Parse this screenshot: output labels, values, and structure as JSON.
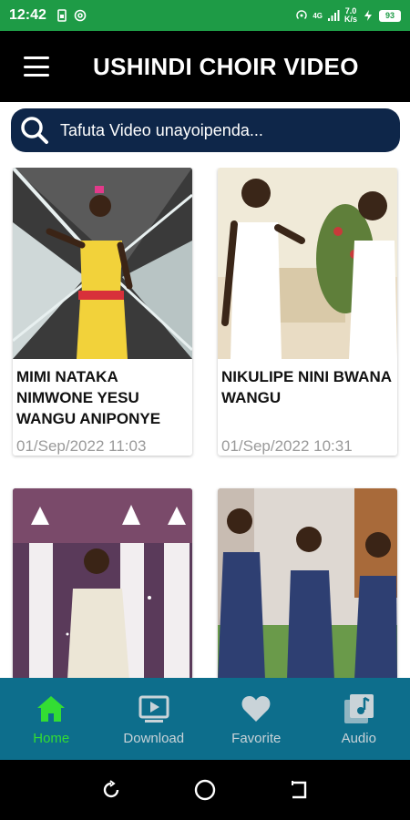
{
  "status_bar": {
    "time": "12:42",
    "net_speed_value": "7.0",
    "net_speed_unit": "K/s",
    "network_type": "4G",
    "battery": "93"
  },
  "app_bar": {
    "title": "USHINDI CHOIR VIDEO"
  },
  "search": {
    "placeholder": "Tafuta Video unayoipenda..."
  },
  "videos": [
    {
      "title": "MIMI NATAKA NIMWONE YESU WANGU ANIPONYE",
      "date": "01/Sep/2022 11:03"
    },
    {
      "title": "NIKULIPE NINI BWANA WANGU",
      "date": "01/Sep/2022 10:31"
    },
    {
      "title": "",
      "date": ""
    },
    {
      "title": "",
      "date": ""
    }
  ],
  "bottom_nav": [
    {
      "label": "Home",
      "icon": "home-icon",
      "active": true
    },
    {
      "label": "Download",
      "icon": "video-download-icon",
      "active": false
    },
    {
      "label": "Favorite",
      "icon": "heart-icon",
      "active": false
    },
    {
      "label": "Audio",
      "icon": "music-note-icon",
      "active": false
    }
  ],
  "colors": {
    "status_bar": "#1e9b46",
    "app_bar": "#000000",
    "search_bar": "#0e2649",
    "bottom_nav": "#0d6e8c",
    "active_nav": "#33dd33",
    "inactive_nav": "#c9d3d8"
  }
}
